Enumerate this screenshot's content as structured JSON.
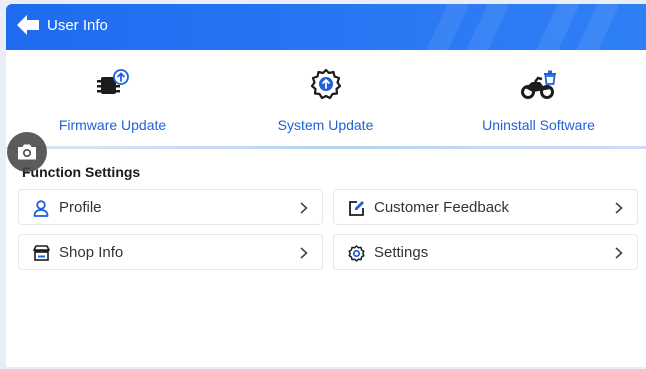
{
  "header": {
    "title": "User Info",
    "back_icon": "arrow-left-icon",
    "color": "#2a78f4"
  },
  "actions": [
    {
      "label": "Firmware Update",
      "icon": "firmware-upload-icon"
    },
    {
      "label": "System Update",
      "icon": "gear-upload-icon"
    },
    {
      "label": "Uninstall Software",
      "icon": "motorcycle-trash-icon"
    }
  ],
  "function_settings": {
    "title": "Function Settings",
    "items": [
      {
        "label": "Profile",
        "icon": "person-icon"
      },
      {
        "label": "Customer Feedback",
        "icon": "edit-icon"
      },
      {
        "label": "Shop Info",
        "icon": "store-icon"
      },
      {
        "label": "Settings",
        "icon": "gear-icon"
      }
    ]
  },
  "floating": {
    "icon": "camera-icon"
  },
  "colors": {
    "accent": "#1f62d6",
    "text": "#333333"
  }
}
